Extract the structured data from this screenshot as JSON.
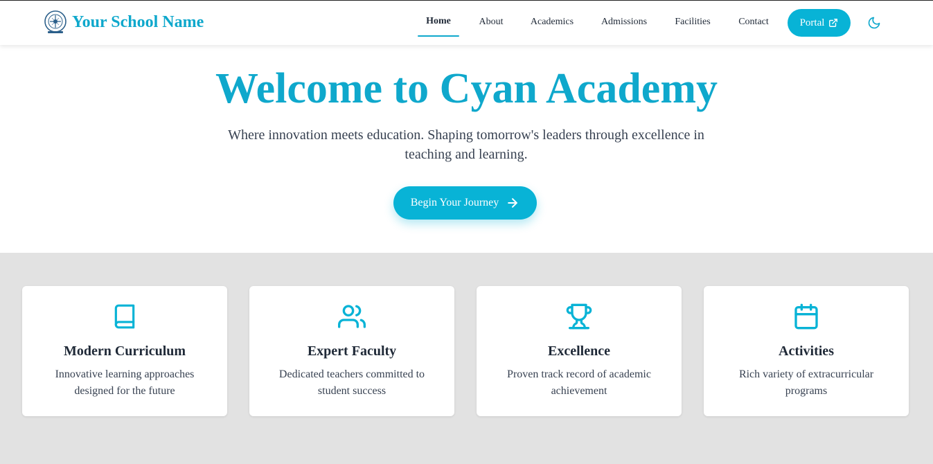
{
  "brand": {
    "name": "Your School Name",
    "logo_icon": "school-crest-icon"
  },
  "colors": {
    "accent": "#08b3d6",
    "brand_text": "#0fa8cc",
    "page_bg": "#e2e2e2"
  },
  "nav": {
    "items": [
      {
        "label": "Home",
        "active": true
      },
      {
        "label": "About"
      },
      {
        "label": "Academics"
      },
      {
        "label": "Admissions"
      },
      {
        "label": "Facilities"
      },
      {
        "label": "Contact"
      }
    ],
    "portal_label": "Portal",
    "portal_icon": "external-link-icon",
    "theme_icon": "moon-icon"
  },
  "hero": {
    "title": "Welcome to Cyan Academy",
    "subtitle": "Where innovation meets education. Shaping tomorrow's leaders through excellence in teaching and learning.",
    "cta_label": "Begin Your Journey",
    "cta_icon": "arrow-right-icon"
  },
  "features": [
    {
      "icon": "book-icon",
      "title": "Modern Curriculum",
      "description": "Innovative learning approaches designed for the future"
    },
    {
      "icon": "users-icon",
      "title": "Expert Faculty",
      "description": "Dedicated teachers committed to student success"
    },
    {
      "icon": "trophy-icon",
      "title": "Excellence",
      "description": "Proven track record of academic achievement"
    },
    {
      "icon": "calendar-icon",
      "title": "Activities",
      "description": "Rich variety of extracurricular programs"
    }
  ]
}
